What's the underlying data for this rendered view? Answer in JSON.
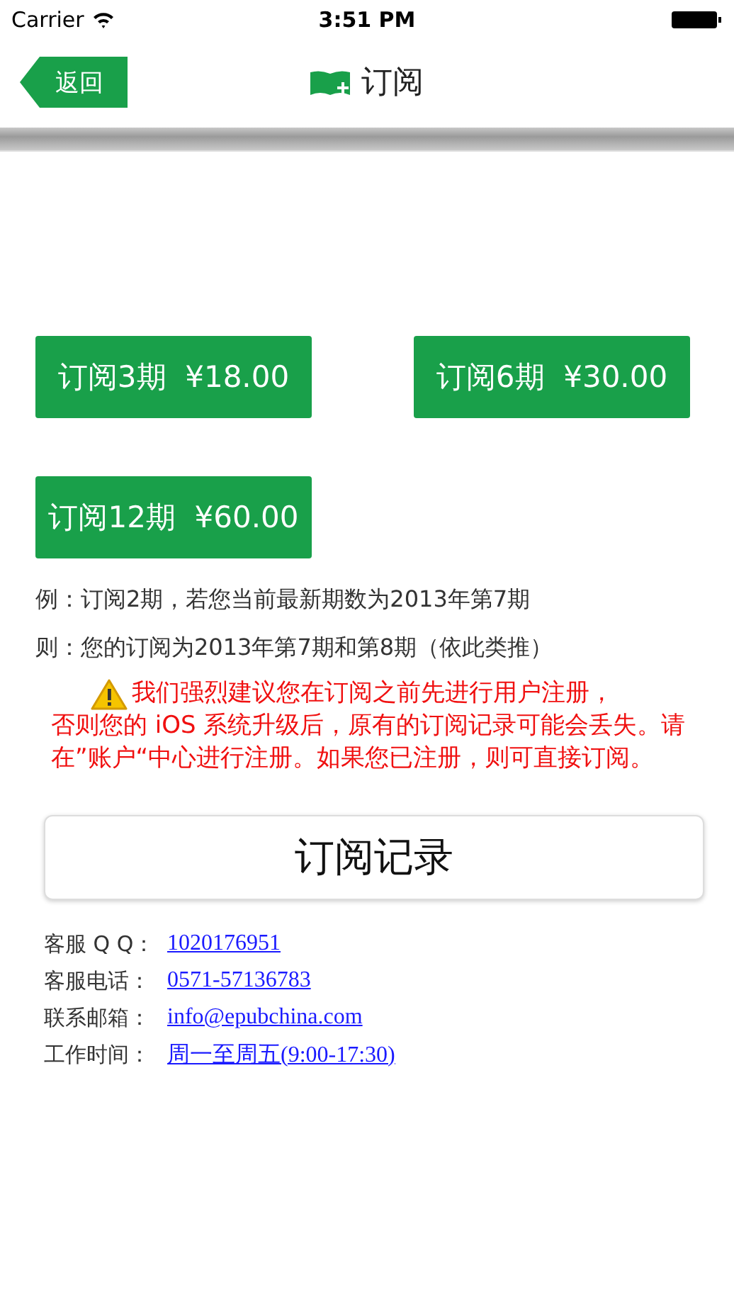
{
  "status_bar": {
    "carrier": "Carrier",
    "time": "3:51 PM"
  },
  "nav": {
    "back": "返回",
    "title": "订阅"
  },
  "plans": [
    {
      "label": "订阅3期",
      "price": "¥18.00"
    },
    {
      "label": "订阅6期",
      "price": "¥30.00"
    },
    {
      "label": "订阅12期",
      "price": "¥60.00"
    }
  ],
  "examples": [
    "例：订阅2期，若您当前最新期数为2013年第7期",
    "则：您的订阅为2013年第7期和第8期（依此类推）"
  ],
  "warning": [
    "我们强烈建议您在订阅之前先进行用户注册，",
    "否则您的 iOS 系统升级后，原有的订阅记录可能会丢失。请在”账户“中心进行注册。如果您已注册，则可直接订阅。"
  ],
  "records_button": "订阅记录",
  "contacts": [
    {
      "label": "客服 Q Q：",
      "value": "1020176951"
    },
    {
      "label": "客服电话：",
      "value": "0571-57136783"
    },
    {
      "label": "联系邮箱：",
      "value": "info@epubchina.com"
    },
    {
      "label": "工作时间：",
      "value": "周一至周五(9:00-17:30)"
    }
  ]
}
